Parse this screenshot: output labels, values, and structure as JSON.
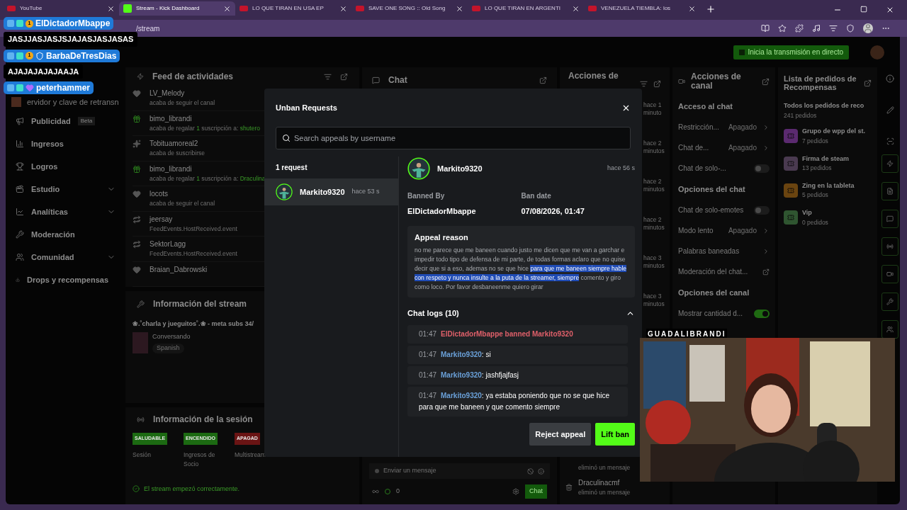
{
  "browser": {
    "tabs": [
      {
        "kind": "youtube",
        "title": "YouTube",
        "selected": false
      },
      {
        "kind": "kick",
        "title": "Stream - Kick Dashboard",
        "selected": true
      },
      {
        "kind": "youtube",
        "title": "LO QUE TIRAN EN USA EP",
        "selected": false
      },
      {
        "kind": "youtube",
        "title": "SAVE ONE SONG :: Old Song",
        "selected": false
      },
      {
        "kind": "youtube",
        "title": "LO QUE TIRAN EN ARGENTI",
        "selected": false
      },
      {
        "kind": "youtube",
        "title": "VENEZUELA TIEMBLA: los",
        "selected": false
      }
    ],
    "address": "/stream"
  },
  "overlay_chat": [
    {
      "user": "ElDictadorMbappe",
      "text": "JASJJASJASJSJAJASJASJASAS",
      "badges": [
        {
          "kind": "coin",
          "text": "1"
        }
      ]
    },
    {
      "user": "BarbaDeTresDias",
      "text": "AJAJAJAJAJAAJA",
      "badges": [
        {
          "kind": "coin",
          "text": "1"
        },
        {
          "kind": "shield"
        }
      ]
    },
    {
      "user": "peterhammer",
      "badges": [
        {
          "kind": "heart"
        }
      ]
    }
  ],
  "sidebar": {
    "partial_item": "ervidor y clave de retransn",
    "items": [
      {
        "label": "Publicidad",
        "badge": "Beta",
        "expandable": false
      },
      {
        "label": "Ingresos",
        "expandable": false
      },
      {
        "label": "Logros",
        "expandable": false
      },
      {
        "label": "Estudio",
        "expandable": true
      },
      {
        "label": "Analíticas",
        "expandable": true
      },
      {
        "label": "Moderación",
        "expandable": false
      },
      {
        "label": "Comunidad",
        "expandable": true
      },
      {
        "label": "Drops y recompensas",
        "expandable": false
      }
    ]
  },
  "topbar": {
    "go_live": "Inicia la transmisión en directo"
  },
  "feed": {
    "title": "Feed de actividades",
    "events": [
      {
        "kind": "follow",
        "user": "LV_Melody",
        "text": "acaba de seguir el canal"
      },
      {
        "kind": "gift",
        "user": "bimo_librandi",
        "text": "acaba de regalar",
        "count": "1",
        "text2": "suscripción a:",
        "recipient": "shutero"
      },
      {
        "kind": "sub",
        "user": "Tobituamoreal2",
        "text": "acaba de suscribirse"
      },
      {
        "kind": "gift",
        "user": "bimo_librandi",
        "text": "acaba de regalar",
        "count": "1",
        "text2": "suscripción a:",
        "recipient": "Draculina"
      },
      {
        "kind": "follow",
        "user": "locots",
        "text": "acaba de seguir el canal"
      },
      {
        "kind": "host",
        "user": "jeersay",
        "text": "FeedEvents.HostReceived.event"
      },
      {
        "kind": "host",
        "user": "SektorLagg",
        "text": "FeedEvents.HostReceived.event"
      },
      {
        "kind": "follow",
        "user": "Braian_Dabrowski"
      }
    ]
  },
  "stream_info": {
    "title": "Información del stream",
    "stream_title": "❀.˚charla y jueguitos˚.❀ - meta subs 34/",
    "category": "Conversando",
    "tag": "Spanish"
  },
  "session": {
    "title": "Información de la sesión",
    "stats": [
      {
        "badge": "SALUDABLE",
        "color": "#1c6a12",
        "label": "Sesión"
      },
      {
        "badge": "ENCENDIDO",
        "color": "#1c6a12",
        "label": "Ingresos de Socio"
      },
      {
        "badge": "APAGAD",
        "color": "#6a1414",
        "label": "Multistream"
      }
    ],
    "message": "El stream empezó correctamente."
  },
  "chat": {
    "title": "Chat",
    "placeholder": "Enviar un mensaje",
    "count": "0",
    "send": "Chat"
  },
  "moderator_actions": {
    "title": "Acciones de",
    "times": [
      "hace 1 minuto",
      "hace 2 minutos",
      "hace 2 minutos",
      "hace 2 minutos",
      "hace 3 minutos",
      "hace 3 minutos"
    ],
    "log": [
      {
        "action": "eliminó un mensaje"
      },
      {
        "user": "Draculinacmf",
        "action": "eliminó un mensaje"
      }
    ]
  },
  "channel_actions": {
    "title": "Acciones de canal",
    "rows": [
      {
        "kind": "heading",
        "label": "Acceso al chat"
      },
      {
        "kind": "select",
        "label": "Restricción...",
        "value": "Apagado"
      },
      {
        "kind": "select",
        "label": "Chat de...",
        "value": "Apagado"
      },
      {
        "kind": "toggle",
        "label": "Chat de solo-...",
        "on": false
      },
      {
        "kind": "heading",
        "label": "Opciones del chat"
      },
      {
        "kind": "toggle",
        "label": "Chat de solo-emotes",
        "on": false
      },
      {
        "kind": "select",
        "label": "Modo lento",
        "value": "Apagado"
      },
      {
        "kind": "link",
        "label": "Palabras baneadas"
      },
      {
        "kind": "external",
        "label": "Moderación del chat..."
      },
      {
        "kind": "heading",
        "label": "Opciones del canal"
      },
      {
        "kind": "toggle",
        "label": "Mostrar cantidad d...",
        "on": true
      }
    ]
  },
  "rewards": {
    "title": "Lista de pedidos de Recompensas",
    "summary": "Todos los pedidos de reco",
    "count": "241 pedidos",
    "items": [
      {
        "name": "Grupo de wpp del st.",
        "count": "7 pedidos",
        "color": "#5b2a70"
      },
      {
        "name": "Firma de steam",
        "count": "13 pedidos",
        "color": "#4a3a50"
      },
      {
        "name": "Zing en la tableta",
        "count": "5 pedidos",
        "color": "#6a4410"
      },
      {
        "name": "Vip",
        "count": "0 pedidos",
        "color": "#2f5530"
      }
    ]
  },
  "modal": {
    "title": "Unban Requests",
    "search_placeholder": "Search appeals by username",
    "request_count": "1 request",
    "requests": [
      {
        "user": "Markito9320",
        "time": "hace 53 s",
        "selected": true
      }
    ],
    "detail": {
      "user": "Markito9320",
      "time": "hace 56 s",
      "banned_by_label": "Banned By",
      "banned_by": "ElDictadorMbappe",
      "ban_date_label": "Ban date",
      "ban_date": "07/08/2026, 01:47",
      "reason_title": "Appeal reason",
      "reason_before": "no me parece que me baneen cuando justo me dicen que me van a garchar e impedir todo tipo de defensa de mi parte, de todas formas aclaro que no quise decir que si a eso, ademas no se que hice",
      "reason_selected": "para que me baneen siempre hable con respeto y nunca insulte a la puta de la streamer, siempre",
      "reason_after": "comento y giro como loco. Por favor desbaneenme quiero girar",
      "logs_title": "Chat logs (10)",
      "logs_expanded": true,
      "logs": [
        {
          "kind": "ban",
          "time": "01:47",
          "text": "ElDictadorMbappe banned Markito9320"
        },
        {
          "kind": "message",
          "time": "01:47",
          "user": "Markito9320",
          "text": ": si"
        },
        {
          "kind": "message",
          "time": "01:47",
          "user": "Markito9320",
          "text": ": jashfjajfasj"
        },
        {
          "kind": "message",
          "time": "01:47",
          "user": "Markito9320",
          "text": ": ya estaba poniendo que no se que hice para que me baneen y que comento siempre"
        }
      ]
    },
    "reject": "Reject appeal",
    "lift": "Lift ban"
  },
  "webcam": {
    "label": "GUADALIBRANDI",
    "kind": "picture"
  }
}
